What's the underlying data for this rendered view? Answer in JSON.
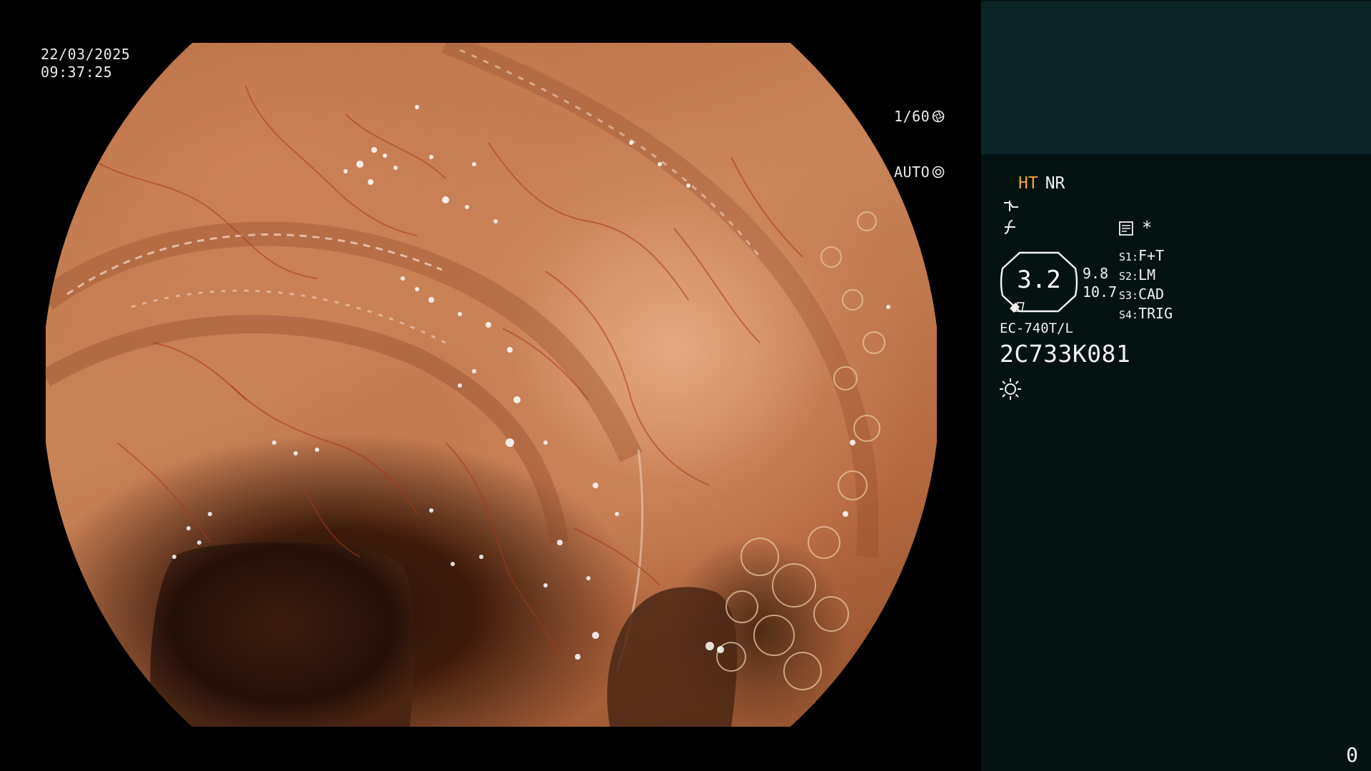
{
  "overlay": {
    "date": "22/03/2025",
    "time": "09:37:25",
    "shutter": "1/60",
    "shutter_icon": "aperture-icon",
    "iris": "AUTO",
    "iris_icon": "iris-icon"
  },
  "panel": {
    "mode_ht": "HT",
    "mode_nr": "NR",
    "mode_ht_color": "#f0a92a",
    "top_bar_color": "#0d2426",
    "panel_color": "#041312",
    "asterisk": "*",
    "zoom_value": "3.2",
    "side_value_top": "9.8",
    "side_value_bottom": "10.7",
    "presets": [
      {
        "key": "S1:",
        "value": "F+T"
      },
      {
        "key": "S2:",
        "value": "LM"
      },
      {
        "key": "S3:",
        "value": "CAD"
      },
      {
        "key": "S4:",
        "value": "TRIG"
      }
    ],
    "scope_model": "EC-740T/L",
    "scope_serial": "2C733K081",
    "counter": "0"
  }
}
